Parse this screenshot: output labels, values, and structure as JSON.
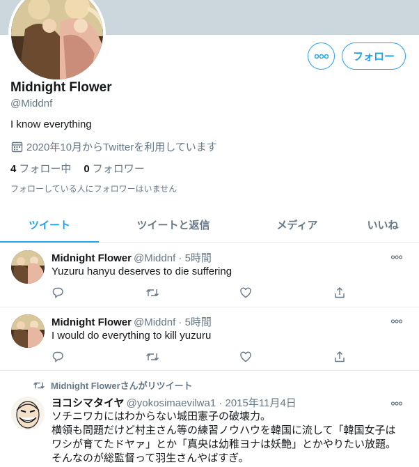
{
  "profile": {
    "name": "Midnight Flower",
    "handle": "@Middnf",
    "bio": "I know everything",
    "joined": "2020年10月からTwitterを利用しています",
    "following_count": "4",
    "following_label": "フォロー中",
    "followers_count": "0",
    "followers_label": "フォロワー",
    "followers_note": "フォローしている人にフォロワーはいません",
    "follow_button": "フォロー"
  },
  "tabs": [
    {
      "label": "ツイート",
      "active": true
    },
    {
      "label": "ツイートと返信",
      "active": false
    },
    {
      "label": "メディア",
      "active": false
    },
    {
      "label": "いいね",
      "active": false
    }
  ],
  "tweets": [
    {
      "name": "Midnight Flower",
      "meta": "@Middnf · 5時間",
      "text": "Yuzuru hanyu deserves to die suffering"
    },
    {
      "name": "Midnight Flower",
      "meta": "@Middnf · 5時間",
      "text": "I would do everything to kill yuzuru"
    }
  ],
  "retweet": {
    "label": "Midnight Flowerさんがリツイート",
    "name": "ヨコシマタイヤ",
    "meta": "@yokosimaevilwa1 · 2015年11月4日",
    "lines": [
      "ソチニワカにはわからない城田憲子の破壊力。",
      "横領も問題だけど村主さん等の練習ノウハウを韓国に流して「韓国女子は",
      "ワシが育てたドヤァ」とか「真央は幼稚ヨナは妖艶」とかやりたい放題。",
      "そんなのが総監督って羽生さんやばすぎ。"
    ]
  },
  "colors": {
    "accent": "#1da1f2",
    "muted": "#657786",
    "banner": "#ccd6dd"
  }
}
